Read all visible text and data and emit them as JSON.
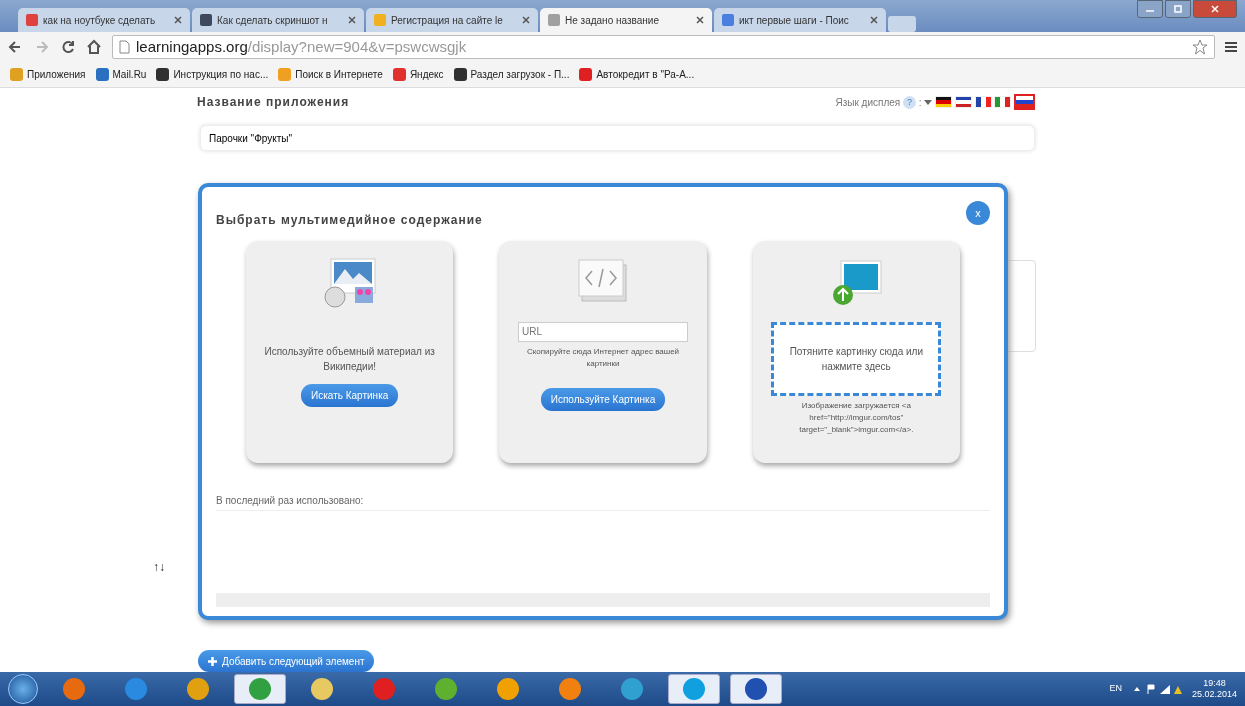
{
  "browser": {
    "tabs": [
      {
        "label": "как на ноутбуке сделать",
        "selected": false,
        "color": "#e04040"
      },
      {
        "label": "Как сделать скриншот н",
        "selected": false,
        "color": "#404860"
      },
      {
        "label": "Регистрация на сайте le",
        "selected": false,
        "color": "#f0b020"
      },
      {
        "label": "Не задано название",
        "selected": true,
        "color": "#a0a0a0"
      },
      {
        "label": "икт первые шаги - Поис",
        "selected": false,
        "color": "#4a7fe0"
      }
    ],
    "url_host": "learningapps.org",
    "url_path": "/display?new=904&v=pswcwsgjk",
    "bookmarks": [
      {
        "label": "Приложения",
        "color": "#e0a020"
      },
      {
        "label": "Mail.Ru",
        "color": "#2a70c0"
      },
      {
        "label": "Инструкция по нас...",
        "color": "#303030"
      },
      {
        "label": "Поиск в Интернете",
        "color": "#f0a020"
      },
      {
        "label": "Яндекс",
        "color": "#e03030"
      },
      {
        "label": "Раздел загрузок - П...",
        "color": "#303030"
      },
      {
        "label": "Автокредит в \"Ра-А...",
        "color": "#e02020"
      }
    ]
  },
  "page": {
    "app_name_label": "Название приложения",
    "language_label": "Язык дисплея",
    "help": "?",
    "separator": ":",
    "languages": [
      {
        "kind": "de",
        "selected": false
      },
      {
        "kind": "gb",
        "selected": false
      },
      {
        "kind": "fr",
        "selected": false
      },
      {
        "kind": "it",
        "selected": false
      },
      {
        "kind": "ru",
        "selected": true
      }
    ],
    "app_name_value": "Парочки \"Фрукты\"",
    "reorder": "↑↓",
    "add_button": "Добавить следующий элемент"
  },
  "modal": {
    "title": "Выбрать мультимедийное содержание",
    "close": "x",
    "cards": [
      {
        "kind": "wiki",
        "text": "Используйте объемный материал из Википедии!",
        "button": "Искать Картинка"
      },
      {
        "kind": "url",
        "placeholder": "URL",
        "text": "Скопируйте сюда Интернет адрес вашей картинки",
        "button": "Используйте Картинка"
      },
      {
        "kind": "upload",
        "drop_text": "Потяните картинку сюда или нажмите здесь",
        "text": "Изображение загружается <a href=\"http://imgur.com/tos\" target=\"_blank\">imgur.com</a>."
      }
    ],
    "last_used_label": "В последний раз использовано:"
  },
  "taskbar": {
    "apps": [
      {
        "color": "#e86a10",
        "active": false
      },
      {
        "color": "#2a8ae0",
        "active": false
      },
      {
        "color": "#e0a010",
        "active": false
      },
      {
        "color": "#30a040",
        "active": true
      },
      {
        "color": "#e8c860",
        "active": false
      },
      {
        "color": "#e02020",
        "active": false
      },
      {
        "color": "#60b030",
        "active": false
      },
      {
        "color": "#f0a000",
        "active": false
      },
      {
        "color": "#f08010",
        "active": false
      },
      {
        "color": "#30a0d0",
        "active": false
      },
      {
        "color": "#10a0e0",
        "active": true
      },
      {
        "color": "#2050b0",
        "active": true
      }
    ],
    "language": "EN",
    "time": "19:48",
    "date": "25.02.2014"
  }
}
